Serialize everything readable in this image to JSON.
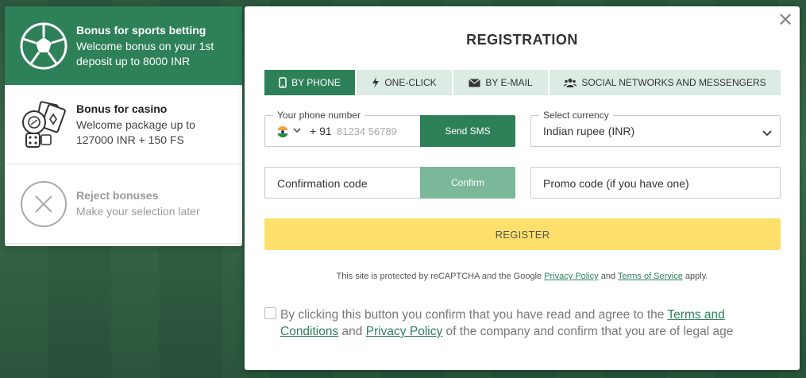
{
  "bonuses": [
    {
      "title": "Bonus for sports betting",
      "desc": "Welcome bonus on your 1st\ndeposit up to 8000 INR",
      "icon": "soccer-ball-icon",
      "active": true
    },
    {
      "title": "Bonus for casino",
      "desc": "Welcome package up to\n127000 INR + 150 FS",
      "icon": "casino-chips-cards-dice-icon",
      "active": false
    },
    {
      "title": "Reject bonuses",
      "desc": "Make your selection later",
      "icon": "close-circle-icon",
      "active": false
    }
  ],
  "modal": {
    "title": "REGISTRATION",
    "close_icon": "close-icon"
  },
  "tabs": [
    {
      "label": "BY PHONE",
      "icon": "phone-icon",
      "active": true
    },
    {
      "label": "ONE-CLICK",
      "icon": "lightning-icon",
      "active": false
    },
    {
      "label": "BY E-MAIL",
      "icon": "envelope-icon",
      "active": false
    },
    {
      "label": "SOCIAL NETWORKS AND MESSENGERS",
      "icon": "people-icon",
      "active": false
    }
  ],
  "phone": {
    "label": "Your phone number",
    "country_code": "+ 91",
    "placeholder": "81234 56789",
    "flag": "india-flag-icon",
    "send_label": "Send SMS"
  },
  "currency": {
    "label": "Select currency",
    "value": "Indian rupee (INR)"
  },
  "confirmation": {
    "placeholder": "Confirmation code",
    "button_label": "Confirm"
  },
  "promo": {
    "placeholder": "Promo code (if you have one)"
  },
  "register_label": "REGISTER",
  "recaptcha": {
    "prefix": "This site is protected by reCAPTCHA and the Google ",
    "privacy_link": "Privacy Policy",
    "middle": " and ",
    "terms_link": "Terms of Service",
    "suffix": " apply."
  },
  "agreement": {
    "prefix": "By clicking this button you confirm that you have read and agree to the ",
    "terms_link": "Terms and Conditions",
    "middle": " and ",
    "privacy_link": "Privacy Policy",
    "suffix": " of the company and confirm that you are of legal age"
  },
  "colors": {
    "brand_green": "#2e8059",
    "tab_inactive": "#dcece4",
    "confirm_disabled": "#7bb89a",
    "register_yellow": "#fde06b"
  }
}
